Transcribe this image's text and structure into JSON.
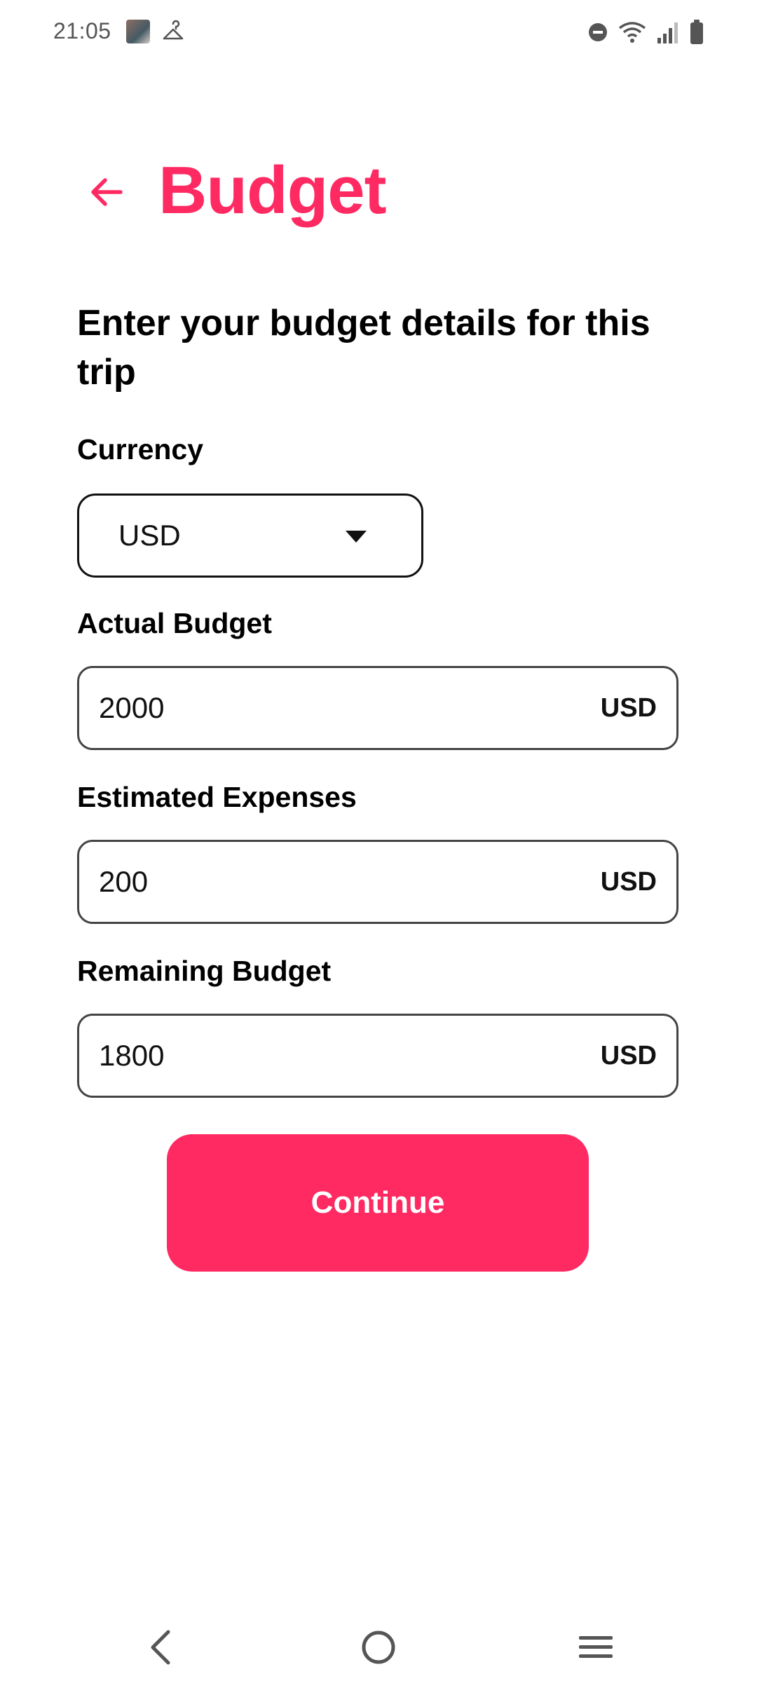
{
  "status_bar": {
    "time": "21:05",
    "icons": [
      "photo-thumbnail-icon",
      "hanger-icon",
      "do-not-disturb-icon",
      "wifi-icon",
      "signal-icon",
      "battery-icon"
    ]
  },
  "header": {
    "title": "Budget",
    "back_icon": "arrow-left-icon"
  },
  "form": {
    "subtitle": "Enter your budget details for this trip",
    "currency": {
      "label": "Currency",
      "selected": "USD"
    },
    "actual_budget": {
      "label": "Actual Budget",
      "value": "2000",
      "suffix": "USD"
    },
    "estimated_expenses": {
      "label": "Estimated Expenses",
      "value": "200",
      "suffix": "USD"
    },
    "remaining_budget": {
      "label": "Remaining Budget",
      "value": "1800",
      "suffix": "USD"
    },
    "continue_label": "Continue"
  },
  "nav_bar": {
    "icons": [
      "nav-back-icon",
      "nav-home-icon",
      "nav-recents-icon"
    ]
  },
  "colors": {
    "accent": "#ff2a62",
    "text": "#000000",
    "background": "#ffffff"
  }
}
